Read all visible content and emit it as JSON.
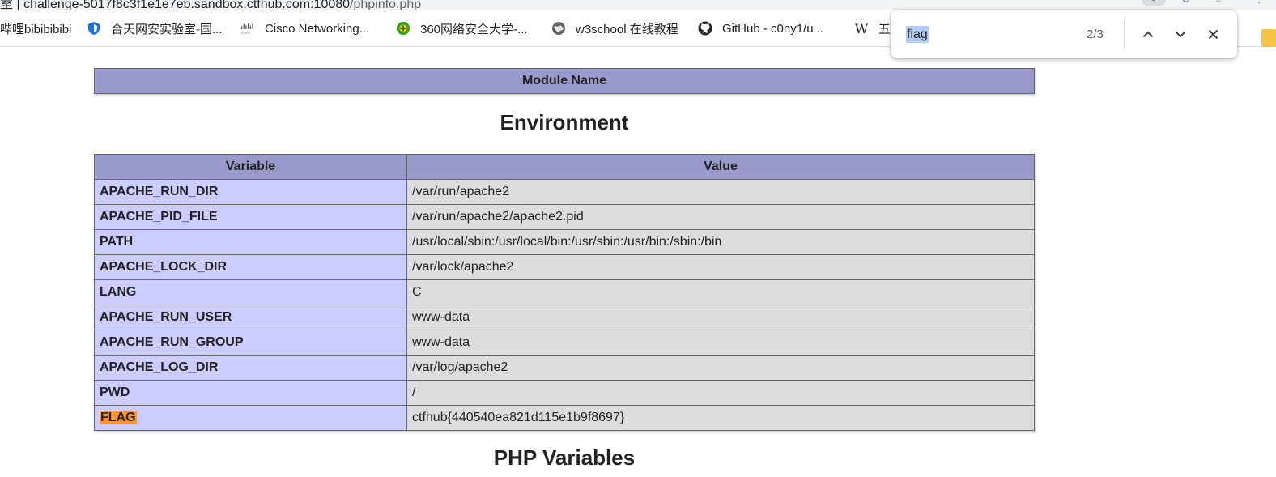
{
  "browser": {
    "address_bar": {
      "host": "challenge-5017f8c3f1e1e7eb.sandbox.ctfhub.com:10080",
      "path": "/phpinfo.php",
      "left_fragment": "室 |"
    },
    "bookmarks": [
      {
        "label": "哔哩bibibibibi",
        "icon": "bilibili-icon"
      },
      {
        "label": "合天网安实验室-国...",
        "icon": "shield-icon"
      },
      {
        "label": "Cisco Networking...",
        "icon": "cisco-icon"
      },
      {
        "label": "360网络安全大学-...",
        "icon": "360-icon"
      },
      {
        "label": "w3school 在线教程",
        "icon": "globe-icon"
      },
      {
        "label": "GitHub - c0ny1/u...",
        "icon": "github-icon"
      },
      {
        "label": "五",
        "icon": "wikipedia-icon"
      }
    ],
    "find_bar": {
      "query": "flag",
      "match_count": "2/3"
    }
  },
  "page": {
    "module_table": {
      "header": "Module Name"
    },
    "environment": {
      "title": "Environment",
      "columns": [
        "Variable",
        "Value"
      ],
      "rows": [
        {
          "variable": "APACHE_RUN_DIR",
          "value": "/var/run/apache2"
        },
        {
          "variable": "APACHE_PID_FILE",
          "value": "/var/run/apache2/apache2.pid"
        },
        {
          "variable": "PATH",
          "value": "/usr/local/sbin:/usr/local/bin:/usr/sbin:/usr/bin:/sbin:/bin"
        },
        {
          "variable": "APACHE_LOCK_DIR",
          "value": "/var/lock/apache2"
        },
        {
          "variable": "LANG",
          "value": "C"
        },
        {
          "variable": "APACHE_RUN_USER",
          "value": "www-data"
        },
        {
          "variable": "APACHE_RUN_GROUP",
          "value": "www-data"
        },
        {
          "variable": "APACHE_LOG_DIR",
          "value": "/var/log/apache2"
        },
        {
          "variable": "PWD",
          "value": "/"
        },
        {
          "variable": "FLAG",
          "value": "ctfhub{440540ea821d115e1b9f8697}"
        }
      ]
    },
    "php_variables": {
      "title": "PHP Variables"
    }
  },
  "colors": {
    "header_bg": "#9999cc",
    "key_bg": "#ccccff",
    "value_bg": "#dddddd",
    "find_match_active": "#ff9632",
    "find_query_selection": "#b3cdf2",
    "bookmark_folder": "#f4c542"
  }
}
